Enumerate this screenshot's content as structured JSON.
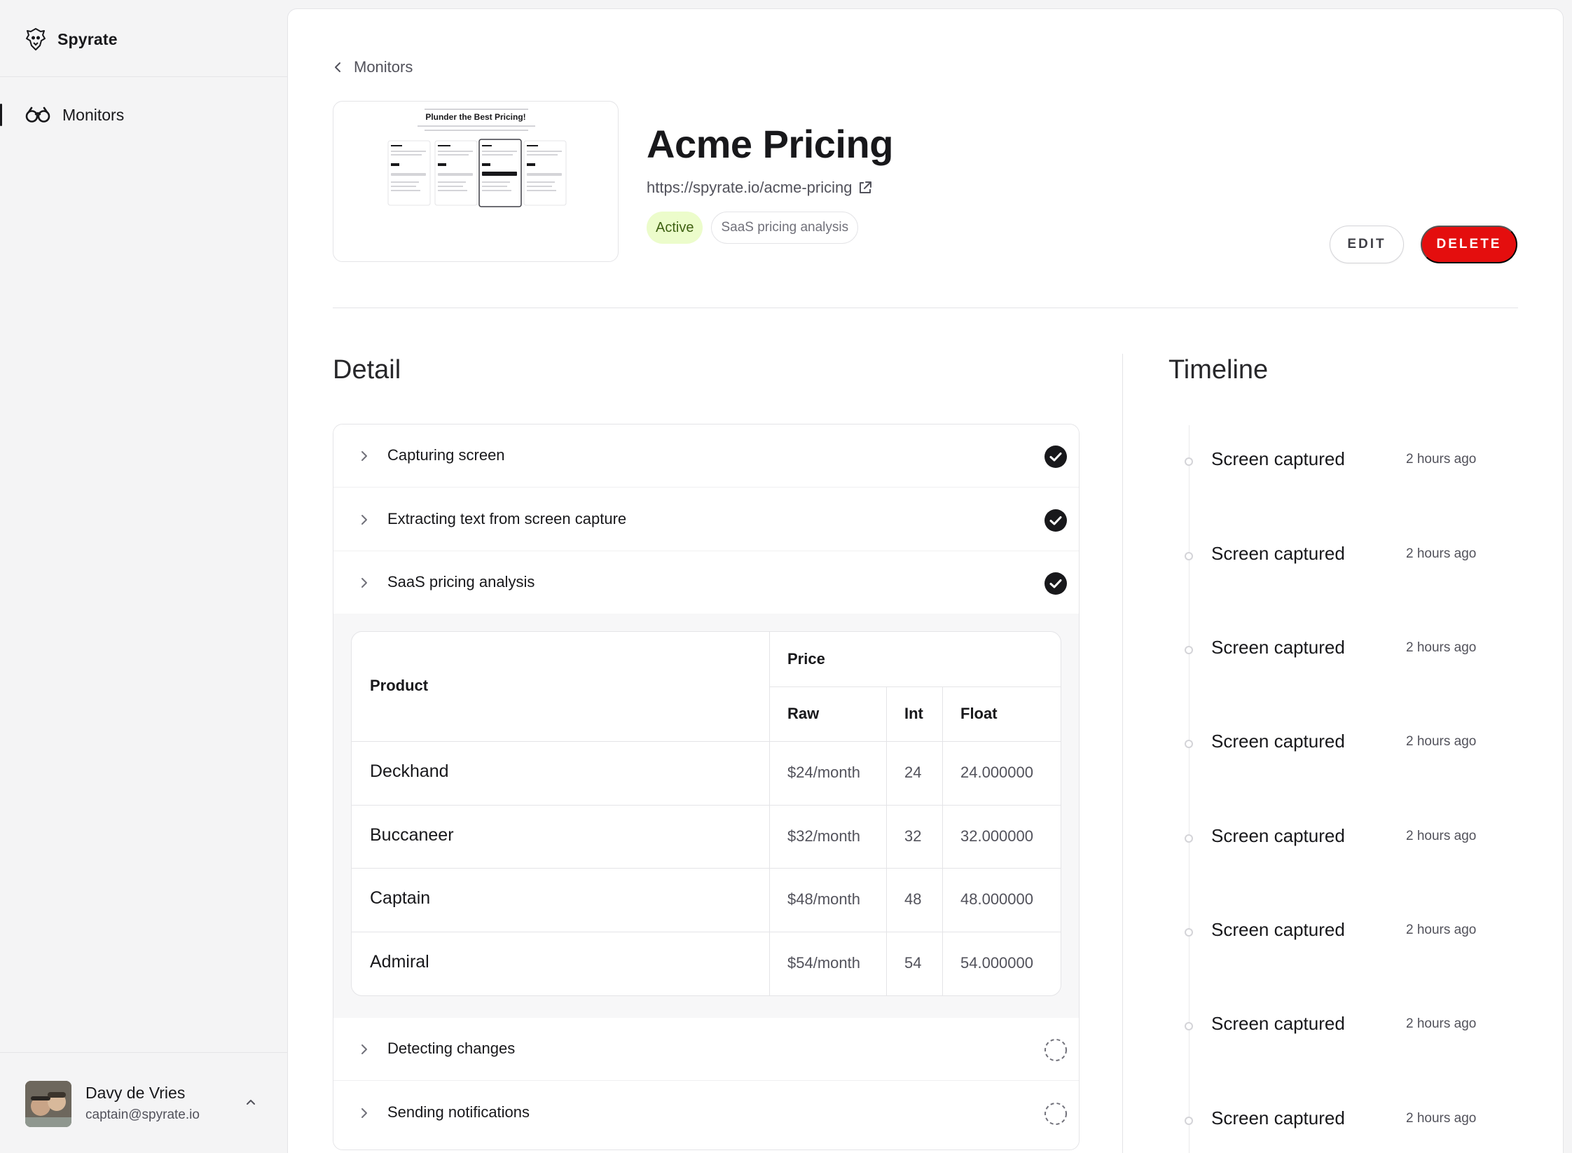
{
  "app": {
    "name": "Spyrate"
  },
  "sidebar": {
    "nav": [
      {
        "label": "Monitors",
        "icon": "binoculars-icon"
      }
    ],
    "user": {
      "name": "Davy de Vries",
      "email": "captain@spyrate.io"
    }
  },
  "breadcrumb": {
    "label": "Monitors"
  },
  "monitor": {
    "title": "Acme Pricing",
    "url": "https://spyrate.io/acme-pricing",
    "status": "Active",
    "tag": "SaaS pricing analysis",
    "thumbnail_title": "Plunder the Best Pricing!"
  },
  "actions": {
    "edit": "EDIT",
    "delete": "DELETE"
  },
  "detail": {
    "title": "Detail",
    "steps": [
      {
        "label": "Capturing screen",
        "status": "done"
      },
      {
        "label": "Extracting text from screen capture",
        "status": "done"
      },
      {
        "label": "SaaS pricing analysis",
        "status": "done"
      },
      {
        "label": "Detecting changes",
        "status": "pending"
      },
      {
        "label": "Sending notifications",
        "status": "pending"
      }
    ],
    "table": {
      "headers": {
        "product": "Product",
        "price": "Price",
        "raw": "Raw",
        "int": "Int",
        "float": "Float"
      },
      "rows": [
        {
          "product": "Deckhand",
          "raw": "$24/month",
          "int": "24",
          "float": "24.000000"
        },
        {
          "product": "Buccaneer",
          "raw": "$32/month",
          "int": "32",
          "float": "32.000000"
        },
        {
          "product": "Captain",
          "raw": "$48/month",
          "int": "48",
          "float": "48.000000"
        },
        {
          "product": "Admiral",
          "raw": "$54/month",
          "int": "54",
          "float": "54.000000"
        }
      ]
    }
  },
  "timeline": {
    "title": "Timeline",
    "items": [
      {
        "label": "Screen captured",
        "time": "2 hours ago"
      },
      {
        "label": "Screen captured",
        "time": "2 hours ago"
      },
      {
        "label": "Screen captured",
        "time": "2 hours ago"
      },
      {
        "label": "Screen captured",
        "time": "2 hours ago"
      },
      {
        "label": "Screen captured",
        "time": "2 hours ago"
      },
      {
        "label": "Screen captured",
        "time": "2 hours ago"
      },
      {
        "label": "Screen captured",
        "time": "2 hours ago"
      },
      {
        "label": "Screen captured",
        "time": "2 hours ago"
      }
    ]
  },
  "colors": {
    "accent_danger": "#e40e0e",
    "active_tag_bg": "#ecfccb",
    "active_tag_text": "#3f6212"
  }
}
